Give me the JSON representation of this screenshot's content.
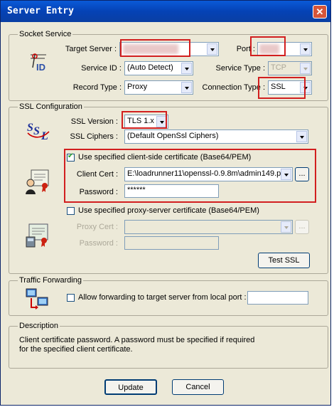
{
  "window": {
    "title": "Server Entry"
  },
  "socket_service": {
    "group_label": "Socket Service",
    "target_server_label": "Target Server :",
    "target_server_value": "",
    "port_label": "Port :",
    "port_value": "",
    "service_id_label": "Service ID :",
    "service_id_value": "(Auto Detect)",
    "service_type_label": "Service Type :",
    "service_type_value": "TCP",
    "record_type_label": "Record Type :",
    "record_type_value": "Proxy",
    "connection_type_label": "Connection Type :",
    "connection_type_value": "SSL"
  },
  "ssl": {
    "group_label": "SSL Configuration",
    "version_label": "SSL Version :",
    "version_value": "TLS 1.x",
    "ciphers_label": "SSL Ciphers :",
    "ciphers_value": "(Default OpenSsl Ciphers)",
    "client_cert_check_label": "Use specified client-side certificate (Base64/PEM)",
    "client_cert_checked": true,
    "client_cert_label": "Client Cert :",
    "client_cert_value": "E:\\loadrunner11\\openssl-0.9.8m\\admin149.pem",
    "password_label": "Password :",
    "password_value": "******",
    "proxy_cert_check_label": "Use specified proxy-server certificate (Base64/PEM)",
    "proxy_cert_checked": false,
    "proxy_cert_label": "Proxy Cert :",
    "proxy_cert_value": "",
    "proxy_password_label": "Password :",
    "proxy_password_value": "",
    "browse_label": "...",
    "test_ssl_label": "Test SSL"
  },
  "traffic": {
    "group_label": "Traffic Forwarding",
    "forward_label": "Allow forwarding to target server from local port :",
    "forward_checked": false,
    "local_port_value": ""
  },
  "description": {
    "group_label": "Description",
    "text_line1": "Client certificate password.  A password must be specified if required",
    "text_line2": "for the specified client certificate."
  },
  "buttons": {
    "update": "Update",
    "cancel": "Cancel"
  },
  "colors": {
    "titlebar": "#0542b5",
    "highlight_box": "#d21f1f",
    "dialog_bg": "#ece9d8"
  },
  "icons": [
    "id-icon",
    "ssl-icon",
    "client-certificate-icon",
    "proxy-certificate-icon",
    "network-forwarding-icon",
    "close-icon"
  ]
}
